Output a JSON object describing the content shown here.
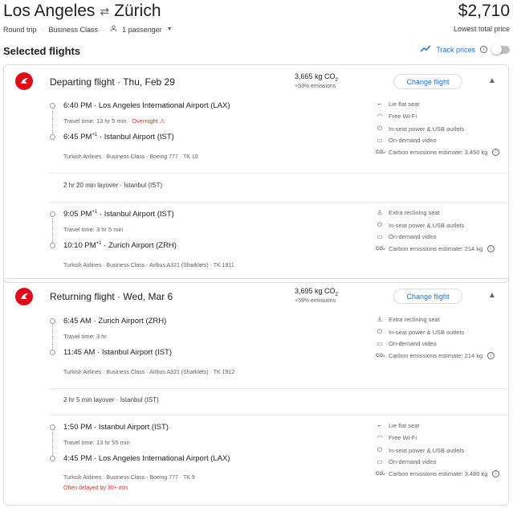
{
  "header": {
    "origin": "Los Angeles",
    "swap_icon": "⇄",
    "destination": "Zürich",
    "price": "$2,710",
    "trip_type": "Round trip",
    "cabin": "Business Class",
    "passengers": "1 passenger",
    "price_note": "Lowest total price"
  },
  "selected": {
    "title": "Selected flights",
    "track_label": "Track prices",
    "track_enabled": false
  },
  "departing": {
    "title": "Departing flight",
    "date": "Thu, Feb 29",
    "co2": "3,665 kg CO",
    "co2_sub": "2",
    "co2_pct": "+53% emissions",
    "change_label": "Change flight",
    "segments": [
      {
        "dep_time": "6:40 PM",
        "dep_sup": "",
        "dep_airport": "Los Angeles International Airport (LAX)",
        "travel": "Travel time: 13 hr 5 min",
        "warning": "Overnight",
        "arr_time": "6:45 PM",
        "arr_sup": "+1",
        "arr_airport": "Istanbul Airport (IST)",
        "details": "Turkish Airlines · Business Class · Boeing 777 · TK 10",
        "delay": "",
        "amenities": [
          {
            "icon": "lie-flat-seat-icon",
            "label": "Lie flat seat"
          },
          {
            "icon": "wifi-icon",
            "label": "Free Wi-Fi"
          },
          {
            "icon": "power-plug-icon",
            "label": "In-seat power & USB outlets"
          },
          {
            "icon": "video-icon",
            "label": "On-demand video"
          },
          {
            "icon": "co2-icon",
            "label": "Carbon emissions estimate: 3,450 kg"
          }
        ]
      },
      {
        "dep_time": "9:05 PM",
        "dep_sup": "+1",
        "dep_airport": "Istanbul Airport (IST)",
        "travel": "Travel time: 3 hr 5 min",
        "warning": "",
        "arr_time": "10:10 PM",
        "arr_sup": "+1",
        "arr_airport": "Zurich Airport (ZRH)",
        "details": "Turkish Airlines · Business Class · Airbus A321 (Sharklets) · TK 1911",
        "delay": "",
        "amenities": [
          {
            "icon": "reclining-seat-icon",
            "label": "Extra reclining seat"
          },
          {
            "icon": "power-plug-icon",
            "label": "In-seat power & USB outlets"
          },
          {
            "icon": "video-icon",
            "label": "On-demand video"
          },
          {
            "icon": "co2-icon",
            "label": "Carbon emissions estimate: 214 kg"
          }
        ]
      }
    ],
    "layover": "2 hr 20 min layover · İstanbul (IST)"
  },
  "returning": {
    "title": "Returning flight",
    "date": "Wed, Mar 6",
    "co2": "3,695 kg CO",
    "co2_sub": "2",
    "co2_pct": "+59% emissions",
    "change_label": "Change flight",
    "segments": [
      {
        "dep_time": "6:45 AM",
        "dep_sup": "",
        "dep_airport": "Zurich Airport (ZRH)",
        "travel": "Travel time: 3 hr",
        "warning": "",
        "arr_time": "11:45 AM",
        "arr_sup": "",
        "arr_airport": "Istanbul Airport (IST)",
        "details": "Turkish Airlines · Business Class · Airbus A321 (Sharklets) · TK 1912",
        "delay": "",
        "amenities": [
          {
            "icon": "reclining-seat-icon",
            "label": "Extra reclining seat"
          },
          {
            "icon": "power-plug-icon",
            "label": "In-seat power & USB outlets"
          },
          {
            "icon": "video-icon",
            "label": "On-demand video"
          },
          {
            "icon": "co2-icon",
            "label": "Carbon emissions estimate: 214 kg"
          }
        ]
      },
      {
        "dep_time": "1:50 PM",
        "dep_sup": "",
        "dep_airport": "Istanbul Airport (IST)",
        "travel": "Travel time: 13 hr 55 min",
        "warning": "",
        "arr_time": "4:45 PM",
        "arr_sup": "",
        "arr_airport": "Los Angeles International Airport (LAX)",
        "details": "Turkish Airlines · Business Class · Boeing 777 · TK 9",
        "delay": "Often delayed by 30+ min",
        "amenities": [
          {
            "icon": "lie-flat-seat-icon",
            "label": "Lie flat seat"
          },
          {
            "icon": "wifi-icon",
            "label": "Free Wi-Fi"
          },
          {
            "icon": "power-plug-icon",
            "label": "In-seat power & USB outlets"
          },
          {
            "icon": "video-icon",
            "label": "On-demand video"
          },
          {
            "icon": "co2-icon",
            "label": "Carbon emissions estimate: 3,480 kg"
          }
        ]
      }
    ],
    "layover": "2 hr 5 min layover · İstanbul (IST)"
  },
  "colors": {
    "accent": "#1a73e8",
    "brand_red": "#e30a17",
    "warning": "#d93025"
  }
}
